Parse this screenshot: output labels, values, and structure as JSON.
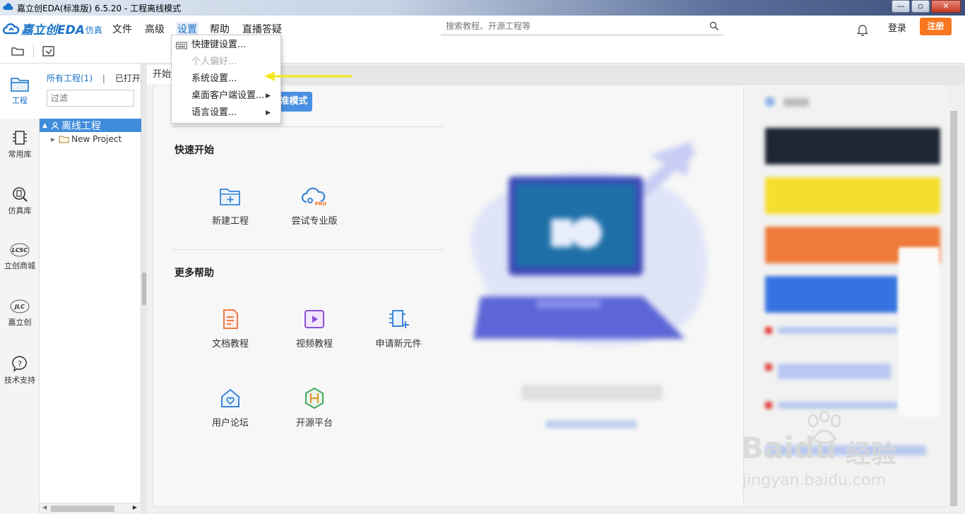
{
  "window": {
    "title": "嘉立创EDA(标准版) 6.5.20 - 工程离线模式",
    "minimize": "—",
    "maximize": "▫",
    "close": "✕"
  },
  "menubar": {
    "logo_text": "嘉立创EDA",
    "logo_sub": "仿真",
    "items": [
      "文件",
      "高级",
      "设置",
      "帮助",
      "直播答疑"
    ],
    "search_placeholder": "搜索教程、开源工程等",
    "login": "登录",
    "register": "注册"
  },
  "sidebar": {
    "items": [
      {
        "label": "工程",
        "icon": "folder-icon"
      },
      {
        "label": "常用库",
        "icon": "chip-icon"
      },
      {
        "label": "仿真库",
        "icon": "sim-lib-icon"
      },
      {
        "label": "立创商城",
        "icon": "lcsc-icon"
      },
      {
        "label": "嘉立创",
        "icon": "jlc-icon"
      },
      {
        "label": "技术支持",
        "icon": "help-icon"
      }
    ]
  },
  "project_panel": {
    "tab_all": "所有工程(1)",
    "tab_sep": "|",
    "tab_open": "已打开工",
    "filter_placeholder": "过滤",
    "tree_root": "离线工程",
    "tree_child": "New Project"
  },
  "main": {
    "tab_label": "开始",
    "mode_button": "准模式",
    "quick_start_title": "快速开始",
    "quick_items": [
      "新建工程",
      "尝试专业版"
    ],
    "more_help_title": "更多帮助",
    "help_items": [
      "文档教程",
      "视频教程",
      "申请新元件",
      "用户论坛",
      "开源平台"
    ]
  },
  "settings_menu": {
    "items": [
      {
        "label": "快捷键设置...",
        "disabled": false,
        "submenu": false
      },
      {
        "label": "个人偏好...",
        "disabled": true,
        "submenu": false
      },
      {
        "label": "系统设置...",
        "disabled": false,
        "submenu": false
      },
      {
        "label": "桌面客户端设置...",
        "disabled": false,
        "submenu": true
      },
      {
        "label": "语言设置...",
        "disabled": false,
        "submenu": true
      }
    ]
  },
  "watermark": {
    "brand": "Baidu",
    "brand_cn": "经验",
    "url": "jingyan.baidu.com"
  },
  "colors": {
    "accent": "#1a73c8",
    "register": "#f7761f",
    "tree_selected": "#3f8cdb",
    "annotation_arrow": "#f5e61a"
  }
}
